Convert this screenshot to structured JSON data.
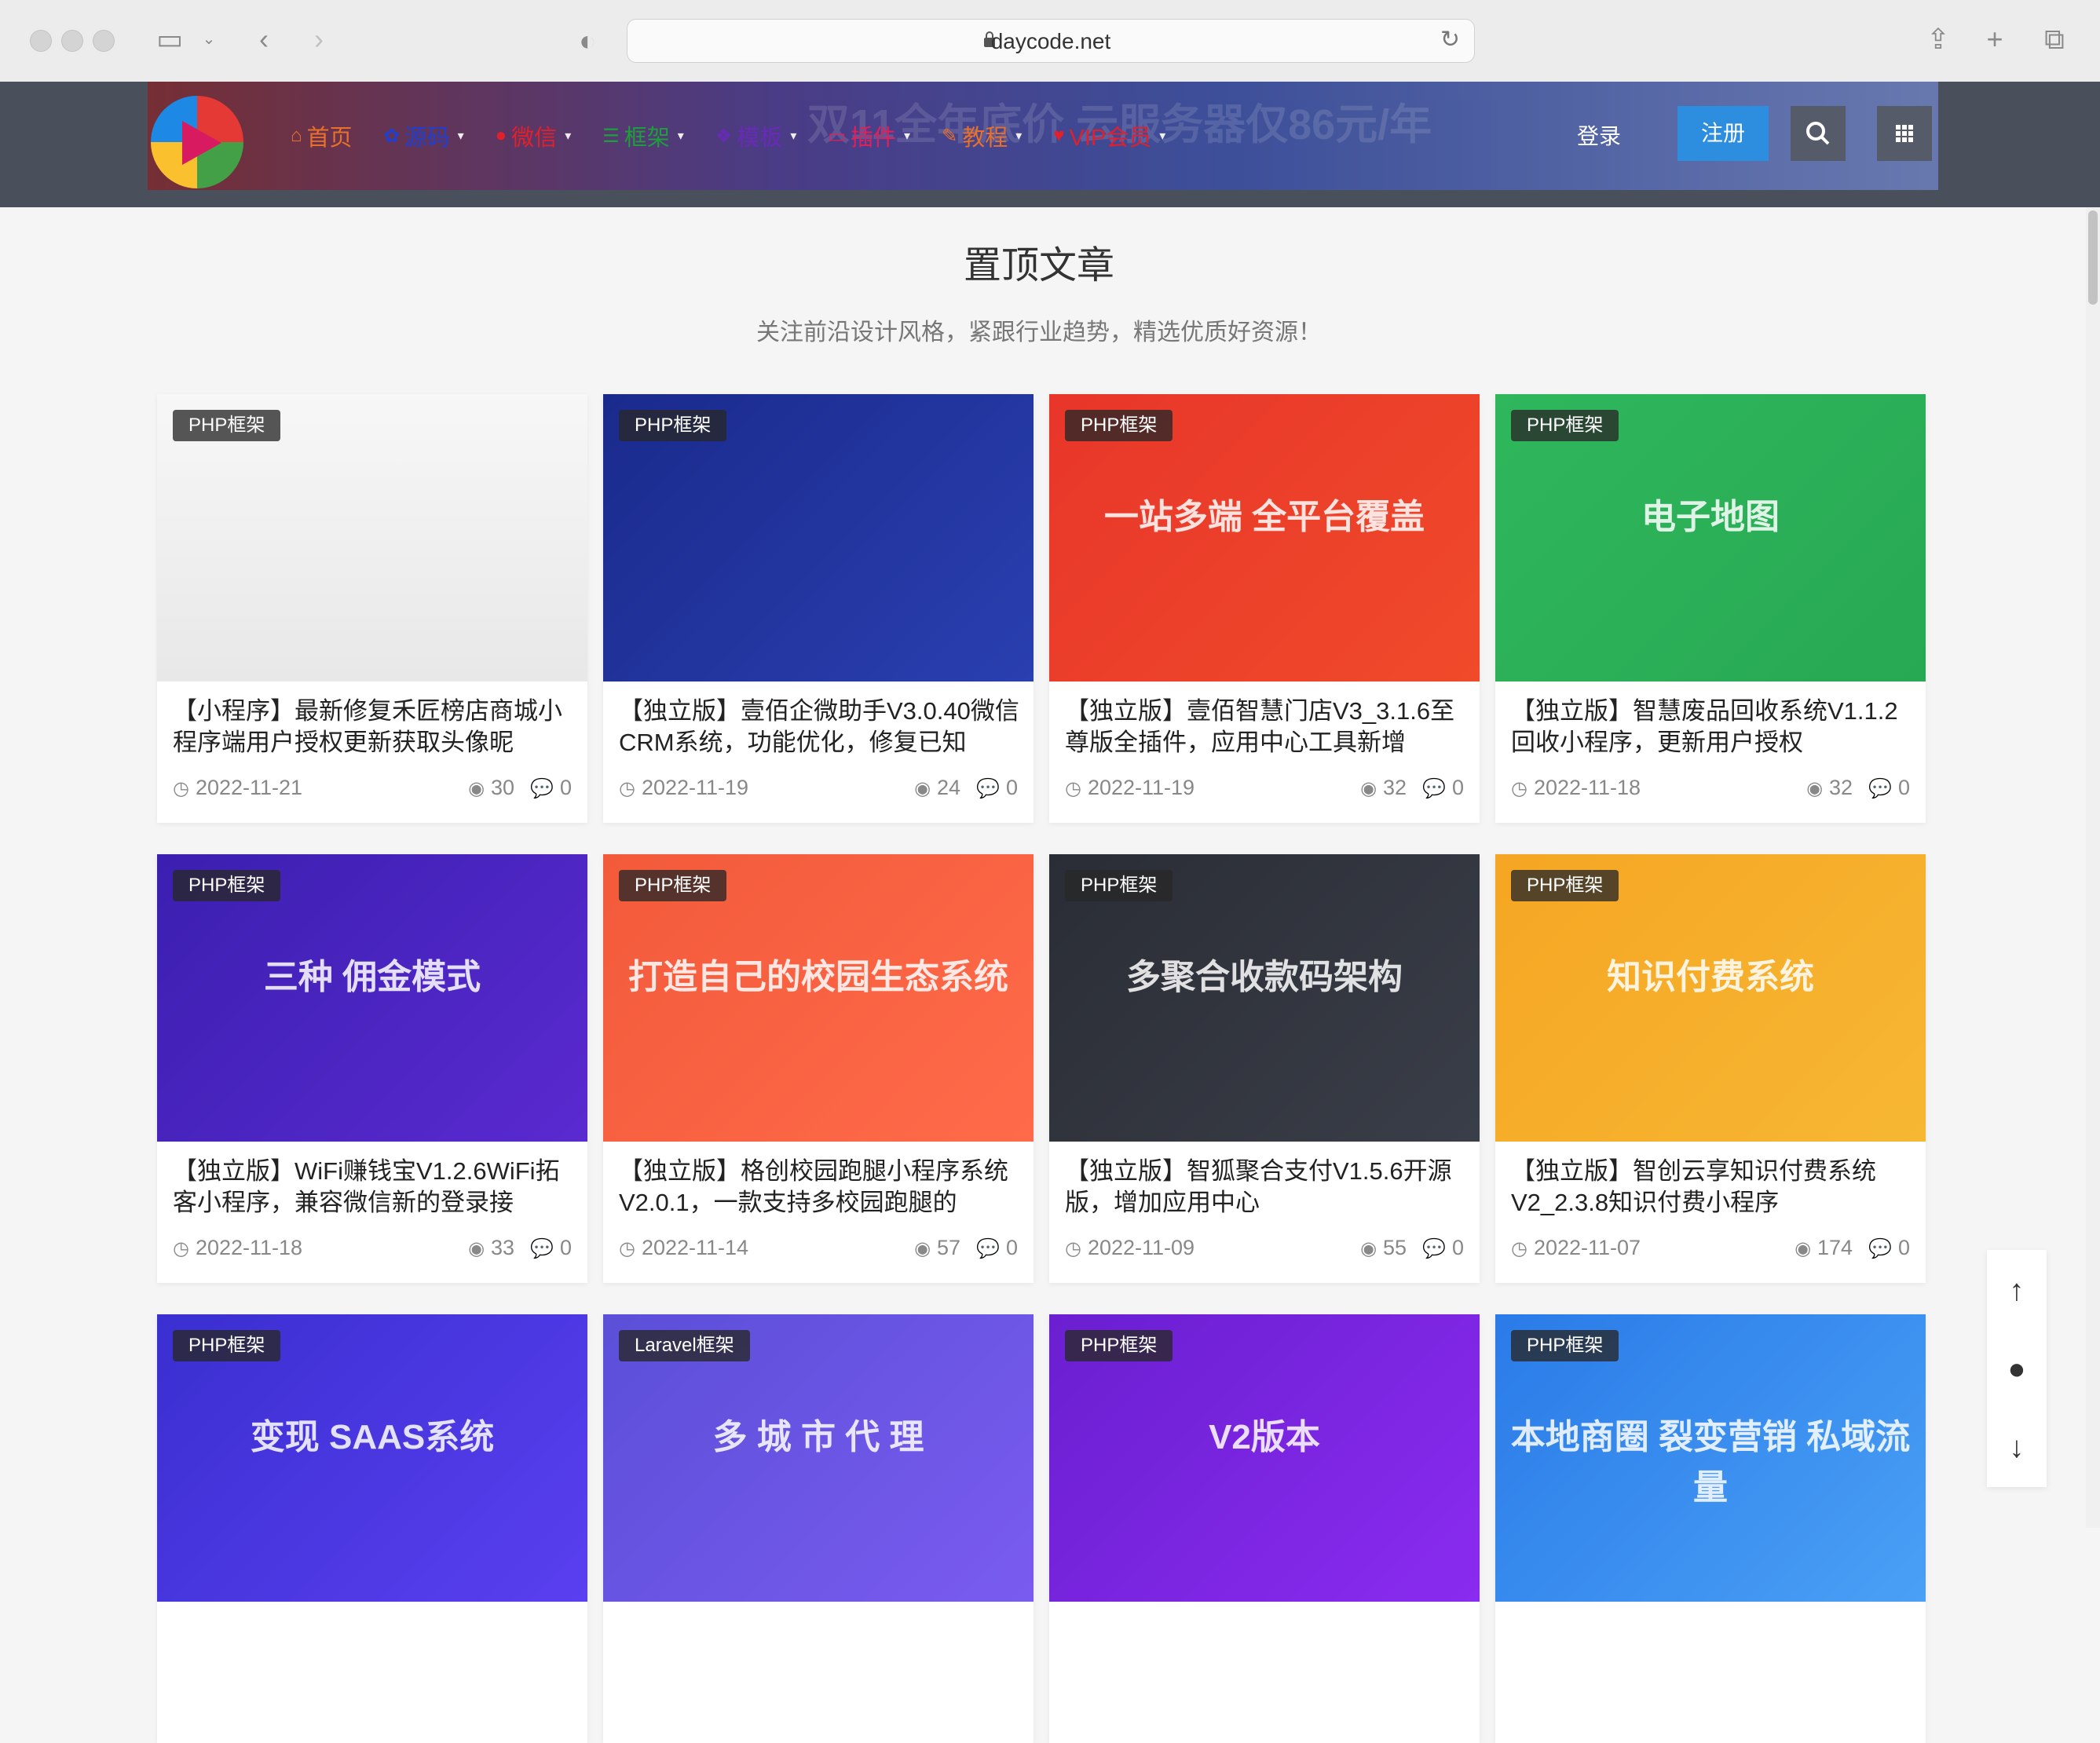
{
  "browser": {
    "url": "daycode.net"
  },
  "header": {
    "nav": [
      {
        "label": "首页",
        "icon": "home-icon",
        "color": "#e8702a"
      },
      {
        "label": "源码",
        "icon": "gear-icon",
        "color": "#1e3fd0"
      },
      {
        "label": "微信",
        "icon": "wechat-icon",
        "color": "#e0202a"
      },
      {
        "label": "框架",
        "icon": "list-icon",
        "color": "#1e9e3a"
      },
      {
        "label": "模板",
        "icon": "tree-icon",
        "color": "#6a2ab8"
      },
      {
        "label": "插件",
        "icon": "monitor-icon",
        "color": "#e0205a"
      },
      {
        "label": "教程",
        "icon": "edit-icon",
        "color": "#e8702a"
      },
      {
        "label": "VIP会员",
        "icon": "heart-icon",
        "color": "#e0202a"
      }
    ],
    "login_label": "登录",
    "register_label": "注册"
  },
  "section": {
    "title": "置顶文章",
    "subtitle": "关注前沿设计风格，紧跟行业趋势，精选优质好资源！"
  },
  "cards": [
    {
      "tag": "PHP框架",
      "title": "【小程序】最新修复禾匠榜店商城小程序端用户授权更新获取头像昵",
      "date": "2022-11-21",
      "views": "30",
      "comments": "0",
      "thumb_text": ""
    },
    {
      "tag": "PHP框架",
      "title": "【独立版】壹佰企微助手V3.0.40微信CRM系统，功能优化，修复已知",
      "date": "2022-11-19",
      "views": "24",
      "comments": "0",
      "thumb_text": ""
    },
    {
      "tag": "PHP框架",
      "title": "【独立版】壹佰智慧门店V3_3.1.6至尊版全插件，应用中心工具新增",
      "date": "2022-11-19",
      "views": "32",
      "comments": "0",
      "thumb_text": "一站多端 全平台覆盖"
    },
    {
      "tag": "PHP框架",
      "title": "【独立版】智慧废品回收系统V1.1.2回收小程序，更新用户授权",
      "date": "2022-11-18",
      "views": "32",
      "comments": "0",
      "thumb_text": "电子地图"
    },
    {
      "tag": "PHP框架",
      "title": "【独立版】WiFi赚钱宝V1.2.6WiFi拓客小程序，兼容微信新的登录接",
      "date": "2022-11-18",
      "views": "33",
      "comments": "0",
      "thumb_text": "三种 佣金模式"
    },
    {
      "tag": "PHP框架",
      "title": "【独立版】格创校园跑腿小程序系统V2.0.1，一款支持多校园跑腿的",
      "date": "2022-11-14",
      "views": "57",
      "comments": "0",
      "thumb_text": "打造自己的校园生态系统"
    },
    {
      "tag": "PHP框架",
      "title": "【独立版】智狐聚合支付V1.5.6开源版，增加应用中心",
      "date": "2022-11-09",
      "views": "55",
      "comments": "0",
      "thumb_text": "多聚合收款码架构"
    },
    {
      "tag": "PHP框架",
      "title": "【独立版】智创云享知识付费系统V2_2.3.8知识付费小程序",
      "date": "2022-11-07",
      "views": "174",
      "comments": "0",
      "thumb_text": "知识付费系统"
    },
    {
      "tag": "PHP框架",
      "title": "",
      "date": "",
      "views": "",
      "comments": "",
      "thumb_text": "变现 SAAS系统"
    },
    {
      "tag": "Laravel框架",
      "title": "",
      "date": "",
      "views": "",
      "comments": "",
      "thumb_text": "多 城 市 代 理"
    },
    {
      "tag": "PHP框架",
      "title": "",
      "date": "",
      "views": "",
      "comments": "",
      "thumb_text": "V2版本"
    },
    {
      "tag": "PHP框架",
      "title": "",
      "date": "",
      "views": "",
      "comments": "",
      "thumb_text": "本地商圈  裂变营销  私域流量"
    }
  ],
  "float_tools": [
    {
      "icon": "arrow-up-icon",
      "glyph": "↑"
    },
    {
      "icon": "qq-penguin-icon",
      "glyph": "●"
    },
    {
      "icon": "arrow-down-icon",
      "glyph": "↓"
    }
  ],
  "colors": {
    "accent": "#2d8ee0",
    "header_bg": "#4a4f5c"
  }
}
